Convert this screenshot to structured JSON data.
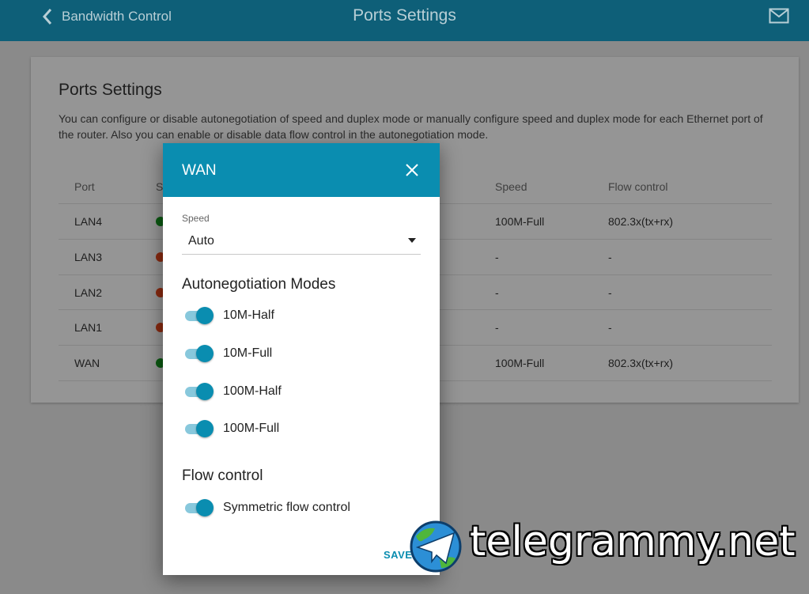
{
  "header": {
    "back_label": "Bandwidth Control",
    "title": "Ports Settings",
    "icons": {
      "back": "chevron-left-icon",
      "mail": "mail-icon"
    }
  },
  "card": {
    "title": "Ports Settings",
    "description": "You can configure or disable autonegotiation of speed and duplex mode or manually configure speed and duplex mode for each Ethernet port of the router. Also you can enable or disable data flow control in the autonegotiation mode.",
    "columns": {
      "port": "Port",
      "status": "S",
      "speed": "Speed",
      "flow": "Flow control"
    },
    "rows": [
      {
        "port": "LAN4",
        "status": "green",
        "speed": "100M-Full",
        "flow": "802.3x(tx+rx)"
      },
      {
        "port": "LAN3",
        "status": "red",
        "speed": "-",
        "flow": "-"
      },
      {
        "port": "LAN2",
        "status": "red",
        "speed": "-",
        "flow": "-"
      },
      {
        "port": "LAN1",
        "status": "red",
        "speed": "-",
        "flow": "-"
      },
      {
        "port": "WAN",
        "status": "green",
        "speed": "100M-Full",
        "flow": "802.3x(tx+rx)"
      }
    ]
  },
  "dialog": {
    "title": "WAN",
    "speed_label": "Speed",
    "speed_value": "Auto",
    "autoneg_title": "Autonegotiation Modes",
    "modes": [
      {
        "label": "10M-Half",
        "on": true
      },
      {
        "label": "10M-Full",
        "on": true
      },
      {
        "label": "100M-Half",
        "on": true
      },
      {
        "label": "100M-Full",
        "on": true
      }
    ],
    "flow_title": "Flow control",
    "flow_toggle": {
      "label": "Symmetric flow control",
      "on": true
    },
    "save_label": "SAVE",
    "icons": {
      "close": "close-icon",
      "dropdown": "caret-down-icon"
    }
  },
  "watermark": {
    "text": "telegrammy.net",
    "logo": "telegram-globe-logo"
  },
  "colors": {
    "header": "#0e5f78",
    "accent": "#0a8db0",
    "toggle_track": "#88c8dc",
    "status_green": "#0b5a12",
    "status_red": "#8a2a10"
  }
}
